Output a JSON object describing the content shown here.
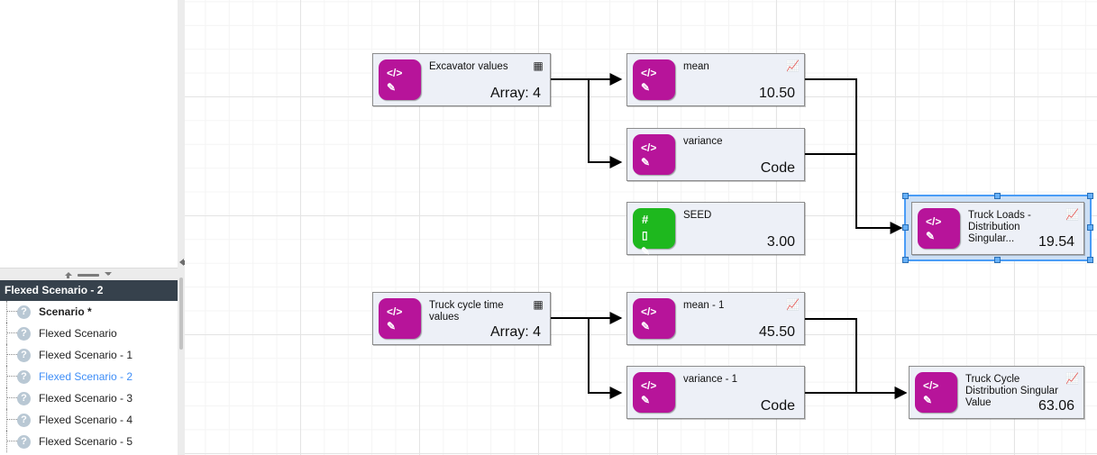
{
  "panel": {
    "header_title": "Flexed Scenario - 2",
    "splitter": {
      "up_icon": "triangle-up-icon",
      "down_icon": "triangle-down-icon",
      "grip_icon": "grip-handle-icon"
    },
    "collapse_icon": "collapse-left-arrow-icon",
    "tree_items": [
      {
        "label": "Scenario *",
        "icon": "question-mark-icon",
        "bold": true,
        "selected": false
      },
      {
        "label": "Flexed Scenario",
        "icon": "question-mark-icon",
        "bold": false,
        "selected": false
      },
      {
        "label": "Flexed Scenario - 1",
        "icon": "question-mark-icon",
        "bold": false,
        "selected": false
      },
      {
        "label": "Flexed Scenario - 2",
        "icon": "question-mark-icon",
        "bold": false,
        "selected": true
      },
      {
        "label": "Flexed Scenario - 3",
        "icon": "question-mark-icon",
        "bold": false,
        "selected": false
      },
      {
        "label": "Flexed Scenario - 4",
        "icon": "question-mark-icon",
        "bold": false,
        "selected": false
      },
      {
        "label": "Flexed Scenario - 5",
        "icon": "question-mark-icon",
        "bold": false,
        "selected": false
      }
    ],
    "question_glyph": "?"
  },
  "colors": {
    "node_fill": "#edf0f7",
    "node_border": "#8c8c8c",
    "icon_magenta": "#b7149a",
    "icon_green": "#1eb81e",
    "selection_blue": "#4a9cf6",
    "panel_header_bg": "#36414c",
    "selected_tree_text": "#3f8ef7"
  },
  "nodes": [
    {
      "id": "excavator-values",
      "title": "Excavator values",
      "value": "Array:  4",
      "icon_color": "magenta",
      "icon_glyphs": [
        "code-icon",
        "pen-edit-icon"
      ],
      "badge": "table-grid-icon",
      "selected": false
    },
    {
      "id": "mean",
      "title": "mean",
      "value": "10.50",
      "icon_color": "magenta",
      "icon_glyphs": [
        "code-icon",
        "pen-edit-icon"
      ],
      "badge": "line-chart-icon",
      "selected": false
    },
    {
      "id": "variance",
      "title": "variance",
      "value": "Code",
      "icon_color": "magenta",
      "icon_glyphs": [
        "code-icon",
        "pen-edit-icon"
      ],
      "badge": "",
      "selected": false
    },
    {
      "id": "seed",
      "title": "SEED",
      "value": "3.00",
      "icon_color": "green",
      "icon_glyphs": [
        "hash-number-icon",
        "rectangle-icon",
        "pen-edit-icon"
      ],
      "badge": "",
      "selected": false
    },
    {
      "id": "truck-loads-distribution",
      "title": "Truck Loads - Distribution Singular...",
      "value": "19.54",
      "icon_color": "magenta",
      "icon_glyphs": [
        "code-icon",
        "pen-edit-icon"
      ],
      "badge": "line-chart-icon",
      "selected": true
    },
    {
      "id": "truck-cycle-time-values",
      "title": "Truck cycle time values",
      "value": "Array:  4",
      "icon_color": "magenta",
      "icon_glyphs": [
        "code-icon",
        "pen-edit-icon"
      ],
      "badge": "table-grid-icon",
      "selected": false
    },
    {
      "id": "mean-1",
      "title": "mean - 1",
      "value": "45.50",
      "icon_color": "magenta",
      "icon_glyphs": [
        "code-icon",
        "pen-edit-icon"
      ],
      "badge": "line-chart-icon",
      "selected": false
    },
    {
      "id": "variance-1",
      "title": "variance - 1",
      "value": "Code",
      "icon_color": "magenta",
      "icon_glyphs": [
        "code-icon",
        "pen-edit-icon"
      ],
      "badge": "",
      "selected": false
    },
    {
      "id": "truck-cycle-distribution",
      "title": "Truck Cycle Distribution Singular Value",
      "value": "63.06",
      "icon_color": "magenta",
      "icon_glyphs": [
        "code-icon",
        "pen-edit-icon"
      ],
      "badge": "line-chart-icon",
      "selected": false
    }
  ],
  "connections": [
    {
      "from": "excavator-values",
      "to": "mean"
    },
    {
      "from": "excavator-values",
      "to": "variance"
    },
    {
      "from": "mean",
      "to": "truck-loads-distribution"
    },
    {
      "from": "variance",
      "to": "truck-loads-distribution"
    },
    {
      "from": "seed",
      "to": "truck-loads-distribution"
    },
    {
      "from": "truck-cycle-time-values",
      "to": "mean-1"
    },
    {
      "from": "truck-cycle-time-values",
      "to": "variance-1"
    },
    {
      "from": "mean-1",
      "to": "truck-cycle-distribution"
    },
    {
      "from": "variance-1",
      "to": "truck-cycle-distribution"
    }
  ]
}
